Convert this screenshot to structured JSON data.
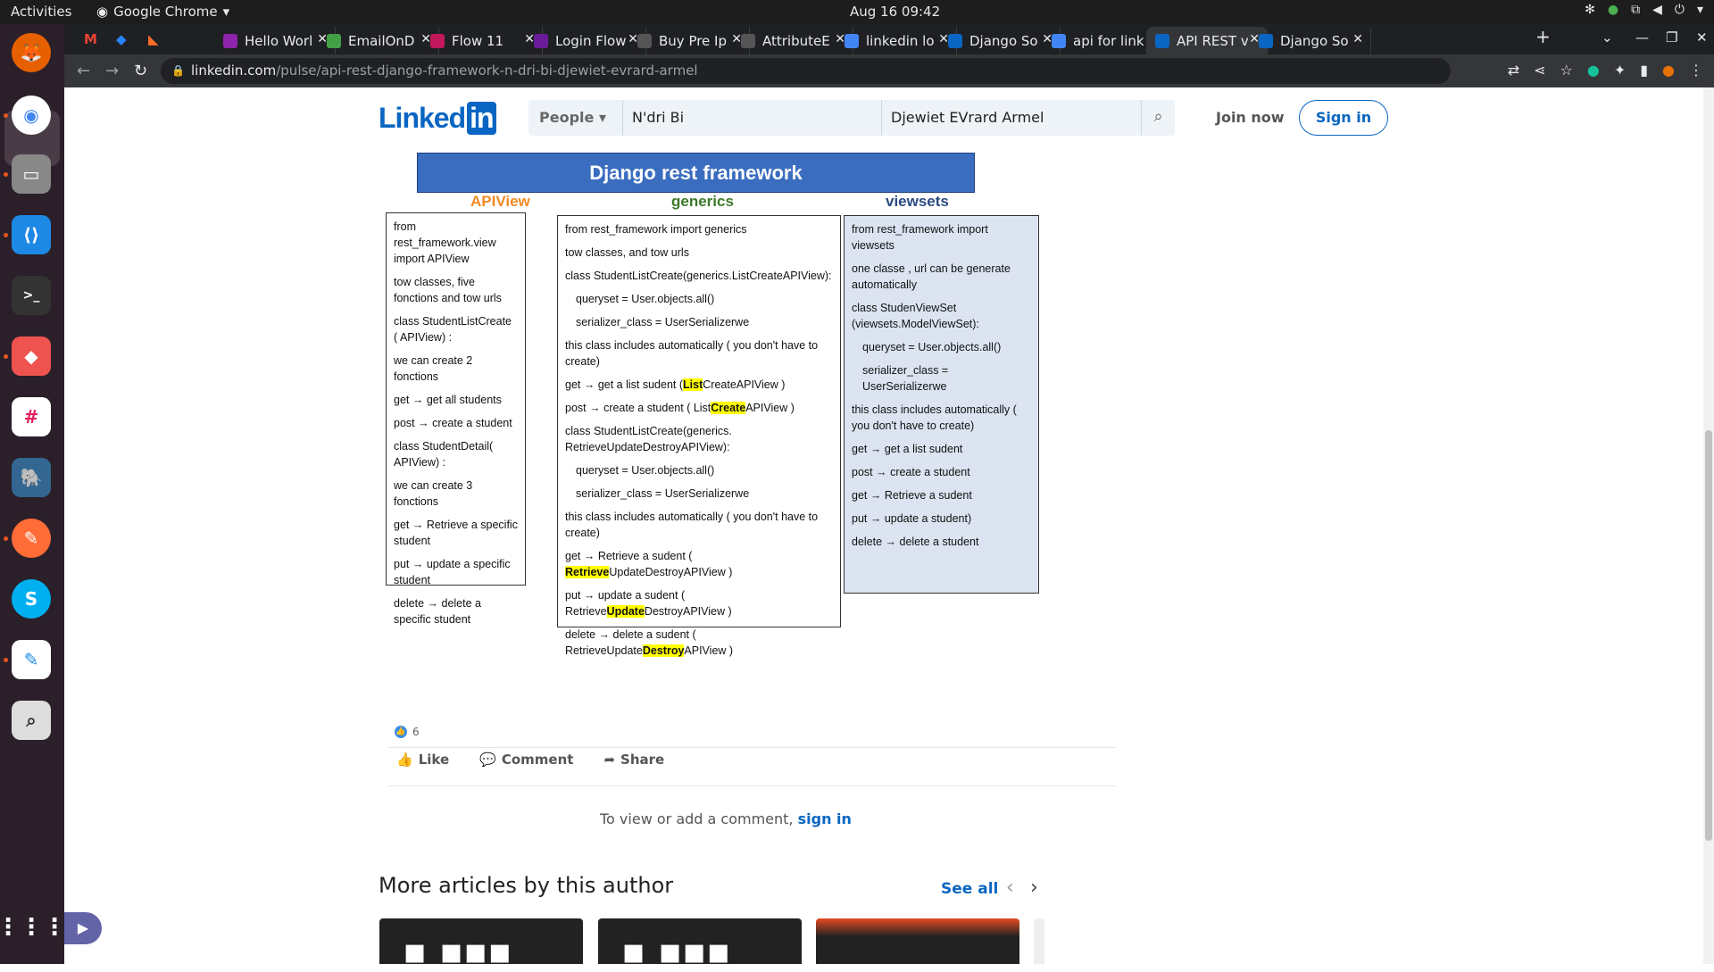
{
  "system": {
    "activities": "Activities",
    "app_name": "Google Chrome",
    "clock": "Aug 16  09:42"
  },
  "tabs": [
    {
      "title": "Hello Worl",
      "color": "#8e24aa"
    },
    {
      "title": "EmailOnD",
      "color": "#43a047"
    },
    {
      "title": "Flow 11",
      "color": "#c2185b"
    },
    {
      "title": "Login Flow",
      "color": "#6a1b9a"
    },
    {
      "title": "Buy Pre Ip",
      "color": "#555555"
    },
    {
      "title": "AttributeE",
      "color": "#555555"
    },
    {
      "title": "linkedin lo",
      "color": "#4285f4"
    },
    {
      "title": "Django So",
      "color": "#0a66c2"
    },
    {
      "title": "api for link",
      "color": "#4285f4"
    },
    {
      "title": "API REST v",
      "color": "#0a66c2"
    },
    {
      "title": "Django So",
      "color": "#0a66c2"
    }
  ],
  "address": {
    "host": "linkedin.com",
    "path": "/pulse/api-rest-django-framework-n-dri-bi-djewiet-evrard-armel"
  },
  "header": {
    "logo_text": "Linked",
    "logo_in": "in",
    "search_category": "People",
    "first_name": "N'dri Bi",
    "last_name": "Djewiet EVrard Armel",
    "join_now": "Join now",
    "sign_in": "Sign in"
  },
  "diagram": {
    "title": "Django rest framework",
    "col_apiview": "APIView",
    "col_generics": "generics",
    "col_viewsets": "viewsets",
    "apiview": [
      "from rest_framework.view import APIView",
      "tow classes,  five fonctions and tow urls",
      "class StudentListCreate ( APIView) :",
      "we can create 2 fonctions",
      "get → get all students",
      "post → create a student",
      "class StudentDetail( APIView) :",
      "we can create 3 fonctions",
      "get → Retrieve a specific student",
      "put → update a specific student",
      "delete → delete a specific student"
    ],
    "generics": {
      "l1": "from rest_framework import generics",
      "l2": "tow classes,  and tow urls",
      "l3": "class StudentListCreate(generics.ListCreateAPIView):",
      "l4": "queryset = User.objects.all()",
      "l5": "serializer_class = UserSerializerwe",
      "l6": "this class includes  automatically ( you don't have to create)",
      "get1_a": "get → get a list sudent  (",
      "get1_hl": "List",
      "get1_b": "CreateAPIView )",
      "post1_a": "post → create a student ( List",
      "post1_hl": "Create",
      "post1_b": "APIView )",
      "l7": "class StudentListCreate(generics. RetrieveUpdateDestroyAPIView):",
      "l8": "queryset = User.objects.all()",
      "l9": "serializer_class = UserSerializerwe",
      "l10": "this class includes  automatically ( you don't have to create)",
      "get2_a": "get → Retrieve a sudent (",
      "get2_hl": "Retrieve",
      "get2_b": "UpdateDestroyAPIView )",
      "put_a": "put → update  a sudent ( Retrieve",
      "put_hl": "Update",
      "put_b": "DestroyAPIView )",
      "del_a": "delete → delete a sudent ( RetrieveUpdate",
      "del_hl": "Destroy",
      "del_b": "APIView )"
    },
    "viewsets": [
      "from rest_framework import viewsets",
      "one classe , url can be generate automatically",
      "class StudenViewSet (viewsets.ModelViewSet):",
      "queryset = User.objects.all()",
      "serializer_class = UserSerializerwe",
      "this class includes  automatically ( you don't have to create)",
      "get → get a list sudent",
      "post → create a student",
      "get → Retrieve a sudent",
      "put → update  a student)",
      "delete → delete a student"
    ]
  },
  "social": {
    "like_count": "6",
    "like": "Like",
    "comment": "Comment",
    "share": "Share",
    "comment_prompt": "To view or add a comment,",
    "sign_in_link": "sign in"
  },
  "more": {
    "heading": "More articles by this author",
    "see_all": "See all"
  }
}
